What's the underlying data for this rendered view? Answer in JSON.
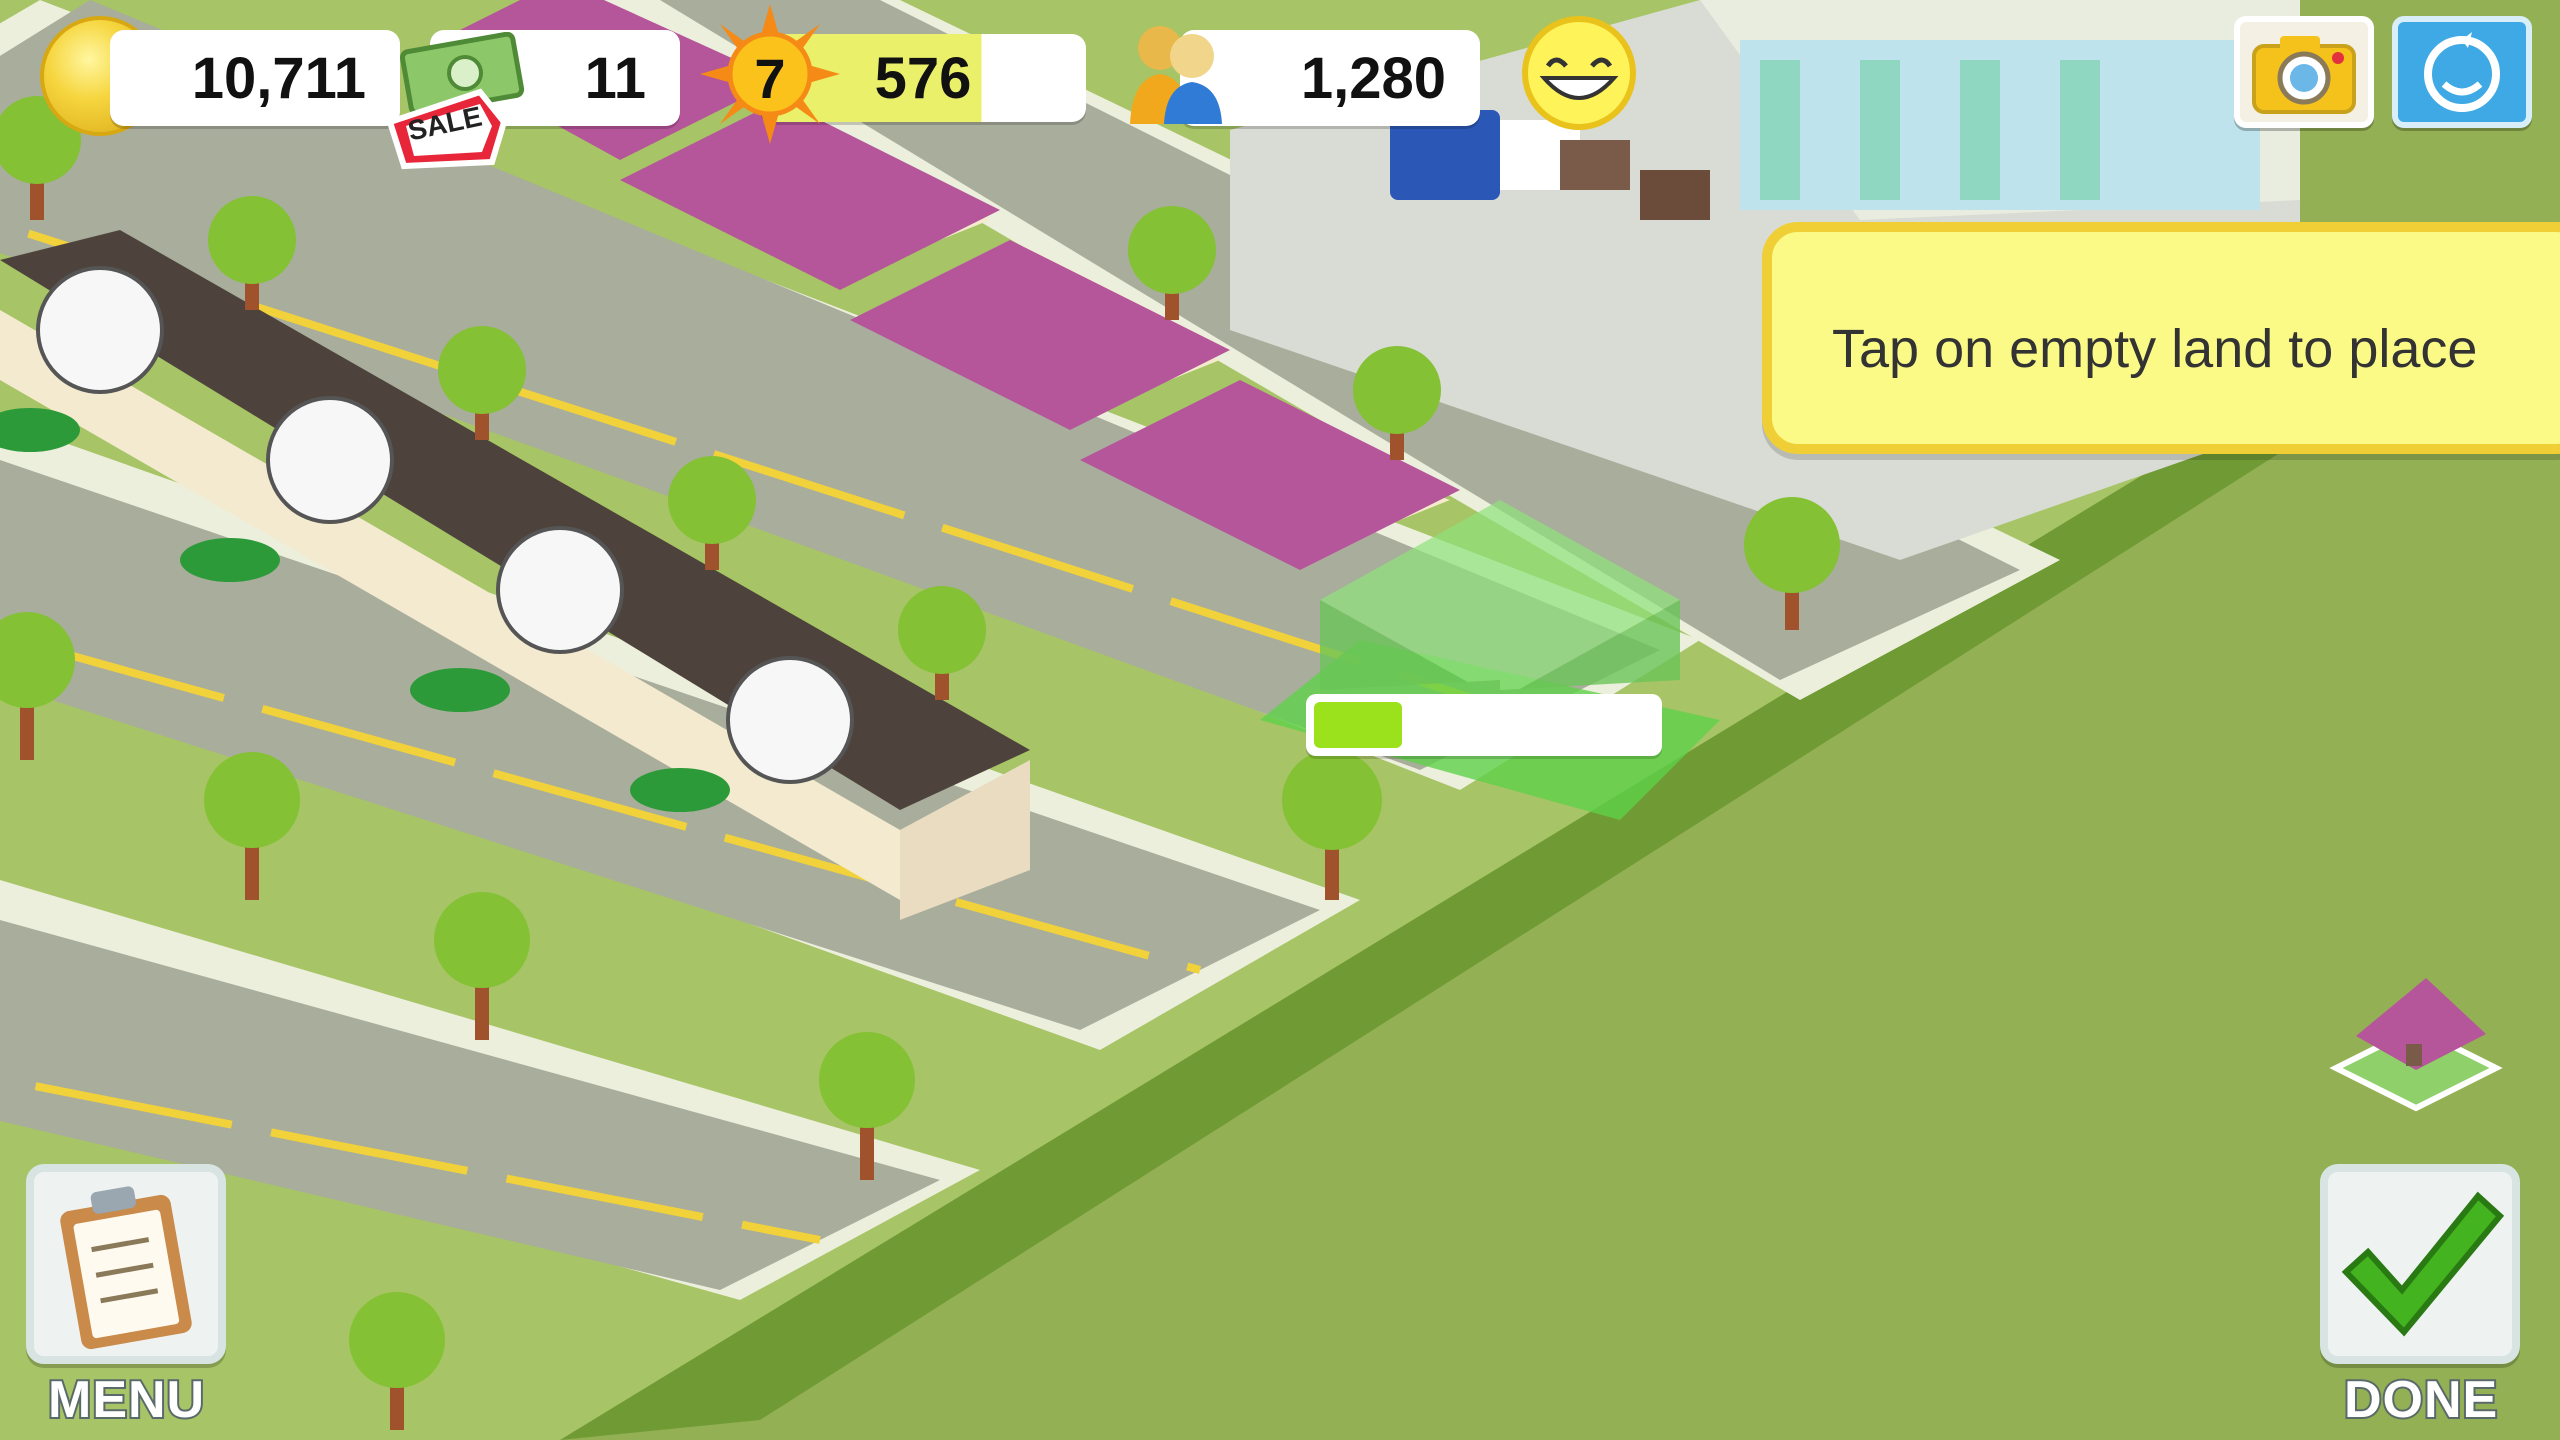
{
  "hud": {
    "coins": "10,711",
    "cash": "11",
    "sale_label": "SALE",
    "level": "7",
    "xp": "576",
    "xp_progress_fraction": 0.68,
    "population": "1,280"
  },
  "tooltip": {
    "text": "Tap on empty land to place"
  },
  "placement": {
    "build_progress_fraction": 0.26
  },
  "buttons": {
    "menu_label": "MENU",
    "done_label": "DONE"
  },
  "colors": {
    "ground": "#93b054",
    "road": "#a9ad9b",
    "sidewalk": "#ecefdc",
    "roof": "#b6569a",
    "tooltip_bg": "#fbfa86",
    "tooltip_border": "#f0cf36",
    "progress_fill": "#9be21c",
    "accent_blue": "#3fa9e6"
  },
  "icons": [
    "coin-icon",
    "cash-icon",
    "sale-tag-icon",
    "sun-level-icon",
    "population-icon",
    "smiley-happiness-icon",
    "camera-icon",
    "share-icon",
    "clipboard-icon",
    "checkmark-icon",
    "house-icon"
  ]
}
